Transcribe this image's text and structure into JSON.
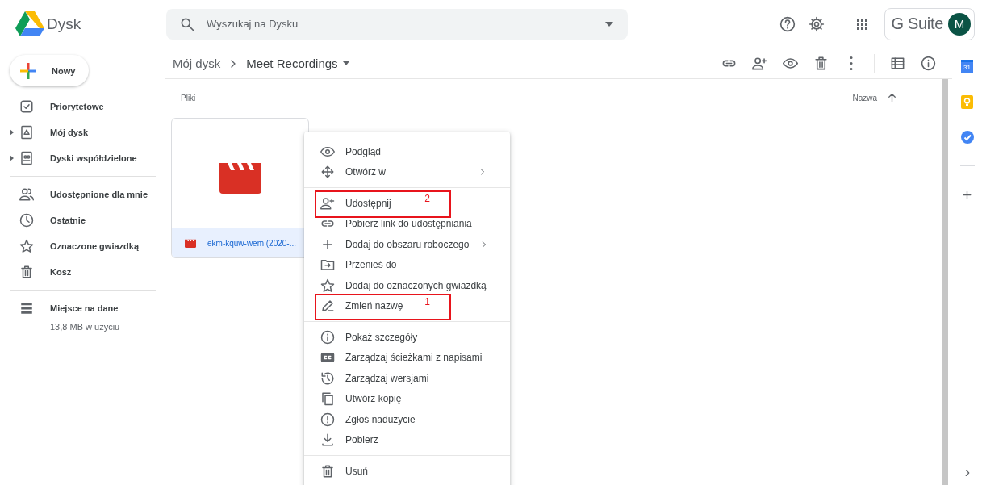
{
  "header": {
    "app_name": "Dysk",
    "search": {
      "placeholder": "Wyszukaj na Dysku"
    },
    "brand": "G Suite",
    "avatar": "M"
  },
  "new_button": {
    "label": "Nowy"
  },
  "sidebar": {
    "groups": [
      [
        {
          "kind": "checkbox",
          "label": "Priorytetowe",
          "expandable": false
        },
        {
          "kind": "drive",
          "label": "Mój dysk",
          "expandable": true
        },
        {
          "kind": "shared-drive",
          "label": "Dyski współdzielone",
          "expandable": true
        }
      ],
      [
        {
          "kind": "people",
          "label": "Udostępnione dla mnie",
          "expandable": false
        },
        {
          "kind": "clock",
          "label": "Ostatnie",
          "expandable": false
        },
        {
          "kind": "star",
          "label": "Oznaczone gwiazdką",
          "expandable": false
        },
        {
          "kind": "trash",
          "label": "Kosz",
          "expandable": false
        }
      ]
    ],
    "storage": {
      "label": "Miejsce na dane",
      "usage": "13,8 MB w użyciu"
    }
  },
  "breadcrumb": [
    {
      "label": "Mój dysk",
      "current": false
    },
    {
      "label": "Meet Recordings",
      "current": true
    }
  ],
  "toolbar": [
    {
      "kind": "link"
    },
    {
      "kind": "person-add"
    },
    {
      "kind": "eye"
    },
    {
      "kind": "trash"
    },
    {
      "kind": "more"
    },
    {
      "kind": "list-view"
    },
    {
      "kind": "info"
    }
  ],
  "section_title": "Pliki",
  "sort": {
    "label": "Nazwa"
  },
  "files": [
    {
      "name": "ekm-kquw-wem (2020-...",
      "selected": true
    }
  ],
  "context_menu": {
    "groups": [
      [
        {
          "kind": "eye",
          "label": "Podgląd",
          "submenu": false
        },
        {
          "kind": "arrows",
          "label": "Otwórz w",
          "submenu": true
        }
      ],
      [
        {
          "kind": "person-add",
          "label": "Udostępnij",
          "submenu": false,
          "annotation": "2"
        },
        {
          "kind": "link",
          "label": "Pobierz link do udostępniania",
          "submenu": false
        },
        {
          "kind": "plus",
          "label": "Dodaj do obszaru roboczego",
          "submenu": true
        },
        {
          "kind": "folder-arrow",
          "label": "Przenieś do",
          "submenu": false
        },
        {
          "kind": "star",
          "label": "Dodaj do oznaczonych gwiazdką",
          "submenu": false
        },
        {
          "kind": "pencil",
          "label": "Zmień nazwę",
          "submenu": false,
          "annotation": "1"
        }
      ],
      [
        {
          "kind": "info",
          "label": "Pokaż szczegóły",
          "submenu": false
        },
        {
          "kind": "captions",
          "label": "Zarządzaj ścieżkami z napisami",
          "submenu": false
        },
        {
          "kind": "history",
          "label": "Zarządzaj wersjami",
          "submenu": false
        },
        {
          "kind": "copy",
          "label": "Utwórz kopię",
          "submenu": false
        },
        {
          "kind": "alert",
          "label": "Zgłoś nadużycie",
          "submenu": false
        },
        {
          "kind": "download",
          "label": "Pobierz",
          "submenu": false
        }
      ],
      [
        {
          "kind": "trash",
          "label": "Usuń",
          "submenu": false
        }
      ]
    ]
  },
  "rail": [
    {
      "kind": "calendar",
      "text": "31"
    },
    {
      "kind": "keep"
    },
    {
      "kind": "tasks"
    }
  ]
}
